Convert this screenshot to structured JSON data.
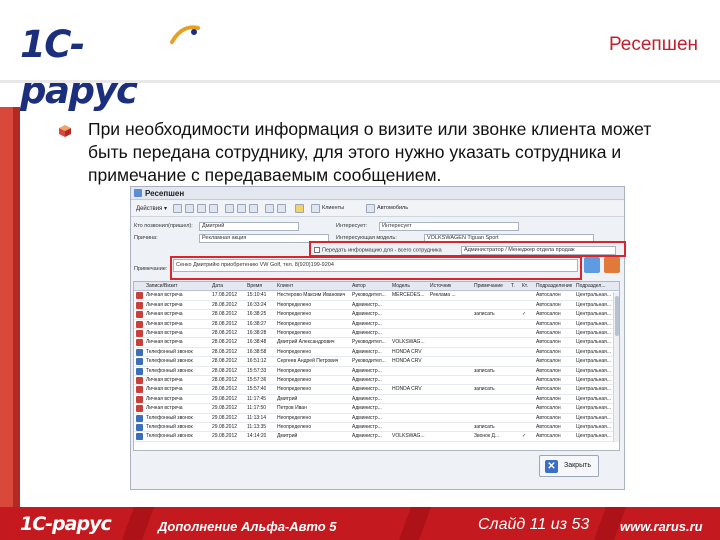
{
  "header": {
    "logo_text": "1С-рарус",
    "title": "Ресепшен"
  },
  "content": {
    "paragraph": "При необходимости информация о визите или звонке клиента может быть передана сотруднику, для этого нужно указать сотрудника и примечание с передаваемым сообщением."
  },
  "window": {
    "title": "Ресепшен",
    "toolbar": {
      "actions_label": "Действия ▾",
      "clients_label": "Клиенты",
      "autos_label": "Автомобиль"
    },
    "form": {
      "client_label": "Кто позвонил(пришел):",
      "client_value": "Дмитрий",
      "interest_label": "Интересует:",
      "interest_value": "Интересует",
      "reason_label": "Причина:",
      "reason_value": "Рекламная акция",
      "car_label": "Интересующая модель:",
      "car_value": "VOLKSWAGEN Tiguan Sport",
      "transfer_label": "Передать информацию для - всего сотрудника",
      "transfer_value": "Администратор / Менеджер отдела продаж",
      "note_label": "Примечание:",
      "note_value": "Сенко Дмитрийю приобретению VW Golf, тел. 8(920)199-9204"
    },
    "table": {
      "headers": [
        "Записи/Визит",
        "Дата",
        "Время",
        "Клиент",
        "Автор",
        "Модель",
        "Источник",
        "Примечание",
        "Т.",
        "Кт.",
        "Подразделение",
        "Подраздел..."
      ],
      "rows": [
        [
          "Личная встреча",
          "17.08.2012",
          "15:10:41",
          "Нестерово Максим Иванович",
          "Руководител...",
          "MERCEDES...",
          "Реклама ...",
          "",
          "",
          "",
          "Автосалон",
          "Центральная..."
        ],
        [
          "Личная встреча",
          "28.08.2012",
          "16:33:24",
          "Неопределено",
          "Администр...",
          "",
          "",
          "",
          "",
          "",
          "Автосалон",
          "Центральная..."
        ],
        [
          "Личная встреча",
          "28.08.2012",
          "16:38:25",
          "Неопределено",
          "Администр...",
          "",
          "",
          "записать",
          "",
          "✓",
          "Автосалон",
          "Центральная..."
        ],
        [
          "Личная встреча",
          "28.08.2012",
          "16:38:27",
          "Неопределено",
          "Администр...",
          "",
          "",
          "",
          "",
          "",
          "Автосалон",
          "Центральная..."
        ],
        [
          "Личная встреча",
          "28.08.2012",
          "16:38:28",
          "Неопределено",
          "Администр...",
          "",
          "",
          "",
          "",
          "",
          "Автосалон",
          "Центральная..."
        ],
        [
          "Личная встреча",
          "28.08.2012",
          "16:38:48",
          "Дмитрий Александрович",
          "Руководител...",
          "VOLKSWAG...",
          "",
          "",
          "",
          "",
          "Автосалон",
          "Центральная..."
        ],
        [
          "Телефонный звонок",
          "28.08.2012",
          "16:38:58",
          "Неопределено",
          "Администр...",
          "HONDA CRV",
          "",
          "",
          "",
          "",
          "Автосалон",
          "Центральная..."
        ],
        [
          "Телефонный звонок",
          "28.08.2012",
          "16:51:12",
          "Сергеев Андрей Петрович",
          "Руководител...",
          "HONDA CRV",
          "",
          "",
          "",
          "",
          "Автосалон",
          "Центральная..."
        ],
        [
          "Телефонный звонок",
          "28.08.2012",
          "15:57:33",
          "Неопределено",
          "Администр...",
          "",
          "",
          "записать",
          "",
          "",
          "Автосалон",
          "Центральная..."
        ],
        [
          "Личная встреча",
          "28.08.2012",
          "15:57:36",
          "Неопределено",
          "Администр...",
          "",
          "",
          "",
          "",
          "",
          "Автосалон",
          "Центральная..."
        ],
        [
          "Личная встреча",
          "28.08.2012",
          "15:57:40",
          "Неопределено",
          "Администр...",
          "HONDA CRV",
          "",
          "записать",
          "",
          "",
          "Автосалон",
          "Центральная..."
        ],
        [
          "Личная встреча",
          "29.08.2012",
          "11:17:45",
          "Дмитрий",
          "Администр...",
          "",
          "",
          "",
          "",
          "",
          "Автосалон",
          "Центральная..."
        ],
        [
          "Личная встреча",
          "29.08.2012",
          "11:17:50",
          "Петров Иван",
          "Администр...",
          "",
          "",
          "",
          "",
          "",
          "Автосалон",
          "Центральная..."
        ],
        [
          "Телефонный звонок",
          "29.08.2012",
          "11:13:14",
          "Неопределено",
          "Администр...",
          "",
          "",
          "",
          "",
          "",
          "Автосалон",
          "Центральная..."
        ],
        [
          "Телефонный звонок",
          "29.08.2012",
          "11:13:35",
          "Неопределено",
          "Администр...",
          "",
          "",
          "записать",
          "",
          "",
          "Автосалон",
          "Центральная..."
        ],
        [
          "Телефонный звонок",
          "29.08.2012",
          "14:14:20",
          "Дмитрий",
          "Администр...",
          "VOLKSWAG...",
          "",
          "Звонок Д...",
          "",
          "✓",
          "Автосалон",
          "Центральная..."
        ]
      ]
    },
    "close_label": "Закрыть"
  },
  "footer": {
    "logo_text": "1С-рарус",
    "product": "Дополнение Альфа-Авто 5",
    "slide": "Слайд 11 из 53",
    "url": "www.rarus.ru"
  },
  "colors": {
    "brand_blue": "#1c2f7d",
    "brand_red": "#c4191f",
    "highlight_red": "#d9252b"
  }
}
